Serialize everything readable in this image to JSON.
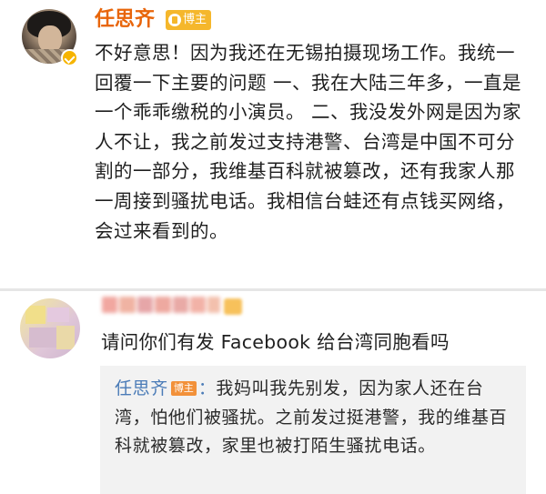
{
  "post": {
    "author": "任思齐",
    "badge": "博主",
    "text": "不好意思！因为我还在无锡拍摄现场工作。我统一回覆一下主要的问题 一、我在大陆三年多，一直是一个乖乖缴税的小演员。 二、我没发外网是因为家人不让，我之前发过支持港警、台湾是中国不可分割的一部分，我维基百科就被篡改，还有我家人那一周接到骚扰电话。我相信台蛙还有点钱买网络，会过来看到的。"
  },
  "comment": {
    "text": "请问你们有发 Facebook 给台湾同胞看吗",
    "reply": {
      "author": "任思齐",
      "badge": "博主",
      "colon": "：",
      "text": "我妈叫我先别发，因为家人还在台湾，怕他们被骚扰。之前发过挺港警，我的维基百科就被篡改，家里也被打陌生骚扰电话。"
    }
  },
  "colors": {
    "author_name": "#e8650a",
    "badge": "#f5b72c",
    "reply_name": "#4a7bb7",
    "reply_bg": "#f2f2f2",
    "separator": "#e6e6e6"
  },
  "icons": {
    "verified": "verified-badge-icon",
    "blogger": "blogger-badge-icon"
  }
}
